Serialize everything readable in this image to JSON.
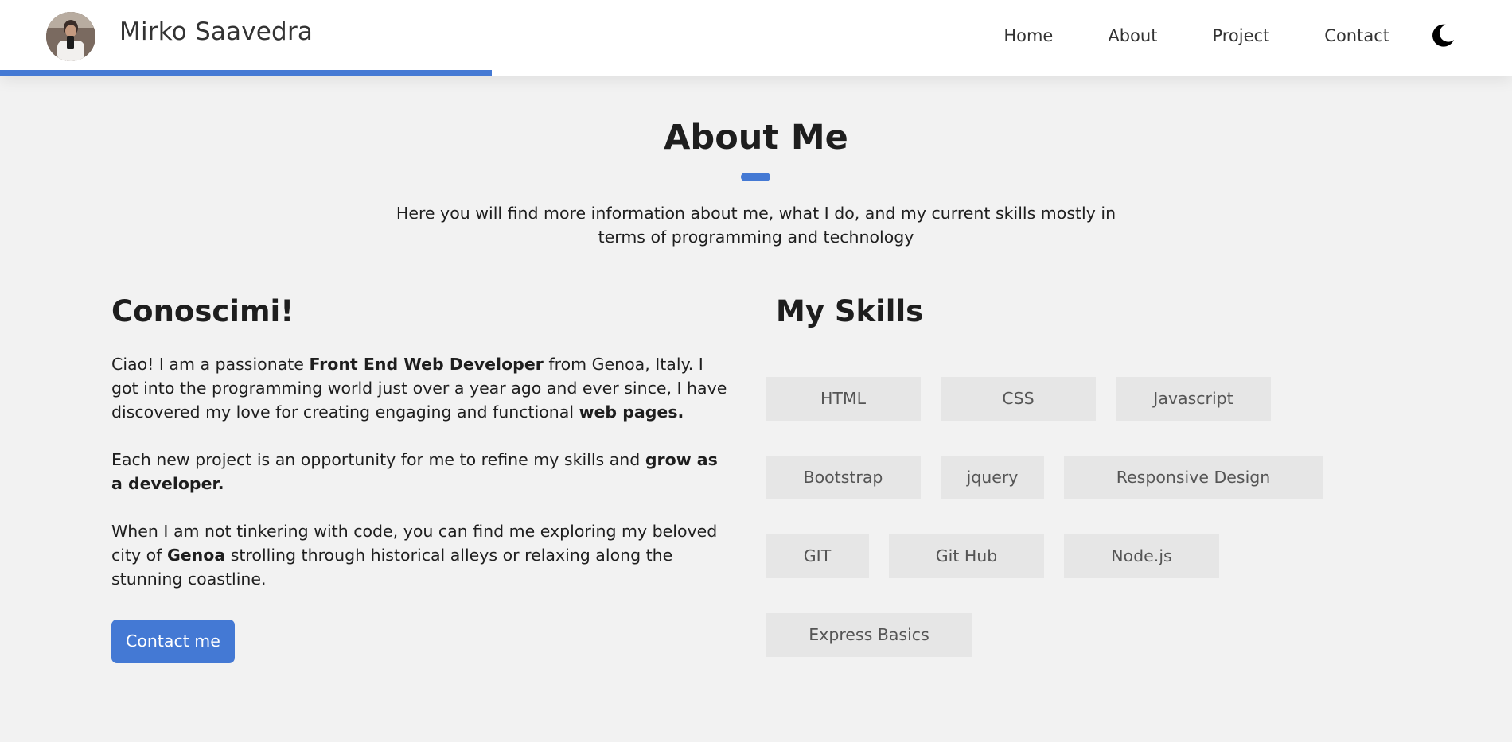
{
  "header": {
    "name": "Mirko Saavedra",
    "nav": [
      "Home",
      "About",
      "Project",
      "Contact"
    ],
    "scroll_progress_percent": 32.5
  },
  "about": {
    "title": "About Me",
    "subtitle": "Here you will find more information about me, what I do, and my current skills mostly in terms of programming and technology"
  },
  "intro": {
    "heading": "Conoscimi!",
    "p1": {
      "t1": "Ciao! I am a passionate ",
      "b1": "Front End Web Developer",
      "t2": " from Genoa, Italy. I got into the programming world just over a year ago and ever since, I have discovered my love for creating engaging and functional ",
      "b2": "web pages."
    },
    "p2": {
      "t1": "Each new project is an opportunity for me to refine my skills and ",
      "b1": "grow as a developer."
    },
    "p3": {
      "t1": "When I am not tinkering with code, you can find me exploring my beloved city of ",
      "b1": "Genoa",
      "t2": " strolling through historical alleys or relaxing along the stunning coastline."
    },
    "button": "Contact me"
  },
  "skills": {
    "heading": "My Skills",
    "items": [
      "HTML",
      "CSS",
      "Javascript",
      "Bootstrap",
      "jquery",
      "Responsive Design",
      "GIT",
      "Git Hub",
      "Node.js",
      "Express Basics"
    ]
  },
  "colors": {
    "accent": "#4479d4",
    "background": "#f2f2f2",
    "skill_bg": "#e6e6e6"
  },
  "icons": {
    "theme_toggle": "moon-icon"
  }
}
